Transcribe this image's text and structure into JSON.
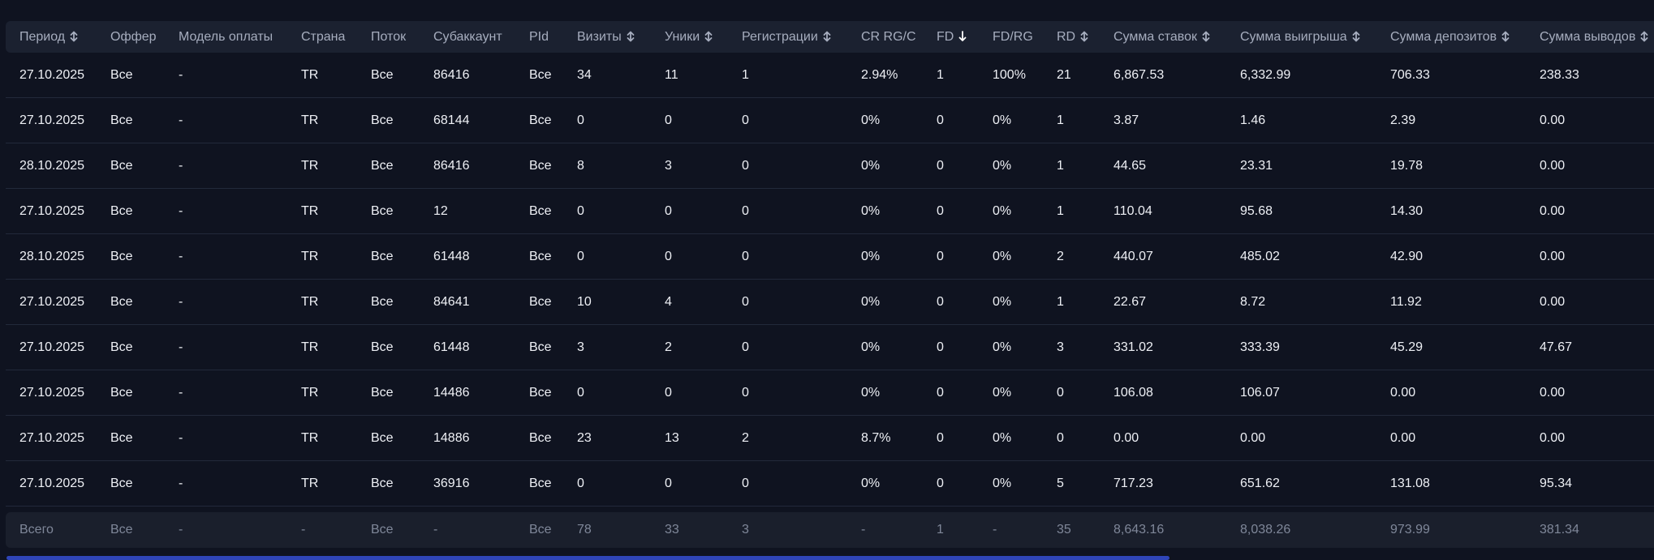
{
  "columns": [
    {
      "label": "Период",
      "sort": "both"
    },
    {
      "label": "Оффер",
      "sort": "none"
    },
    {
      "label": "Модель оплаты",
      "sort": "none"
    },
    {
      "label": "Страна",
      "sort": "none"
    },
    {
      "label": "Поток",
      "sort": "none"
    },
    {
      "label": "Субаккаунт",
      "sort": "none"
    },
    {
      "label": "PId",
      "sort": "none"
    },
    {
      "label": "Визиты",
      "sort": "both"
    },
    {
      "label": "Уники",
      "sort": "both"
    },
    {
      "label": "Регистрации",
      "sort": "both"
    },
    {
      "label": "CR RG/C",
      "sort": "none"
    },
    {
      "label": "FD",
      "sort": "down"
    },
    {
      "label": "FD/RG",
      "sort": "none"
    },
    {
      "label": "RD",
      "sort": "both"
    },
    {
      "label": "Сумма ставок",
      "sort": "both"
    },
    {
      "label": "Сумма выигрыша",
      "sort": "both"
    },
    {
      "label": "Сумма депозитов",
      "sort": "both"
    },
    {
      "label": "Сумма выводов",
      "sort": "both"
    }
  ],
  "rows": [
    [
      "27.10.2025",
      "Все",
      "-",
      "TR",
      "Все",
      "86416",
      "Все",
      "34",
      "11",
      "1",
      "2.94%",
      "1",
      "100%",
      "21",
      "6,867.53",
      "6,332.99",
      "706.33",
      "238.33"
    ],
    [
      "27.10.2025",
      "Все",
      "-",
      "TR",
      "Все",
      "68144",
      "Все",
      "0",
      "0",
      "0",
      "0%",
      "0",
      "0%",
      "1",
      "3.87",
      "1.46",
      "2.39",
      "0.00"
    ],
    [
      "28.10.2025",
      "Все",
      "-",
      "TR",
      "Все",
      "86416",
      "Все",
      "8",
      "3",
      "0",
      "0%",
      "0",
      "0%",
      "1",
      "44.65",
      "23.31",
      "19.78",
      "0.00"
    ],
    [
      "27.10.2025",
      "Все",
      "-",
      "TR",
      "Все",
      "12",
      "Все",
      "0",
      "0",
      "0",
      "0%",
      "0",
      "0%",
      "1",
      "110.04",
      "95.68",
      "14.30",
      "0.00"
    ],
    [
      "28.10.2025",
      "Все",
      "-",
      "TR",
      "Все",
      "61448",
      "Все",
      "0",
      "0",
      "0",
      "0%",
      "0",
      "0%",
      "2",
      "440.07",
      "485.02",
      "42.90",
      "0.00"
    ],
    [
      "27.10.2025",
      "Все",
      "-",
      "TR",
      "Все",
      "84641",
      "Все",
      "10",
      "4",
      "0",
      "0%",
      "0",
      "0%",
      "1",
      "22.67",
      "8.72",
      "11.92",
      "0.00"
    ],
    [
      "27.10.2025",
      "Все",
      "-",
      "TR",
      "Все",
      "61448",
      "Все",
      "3",
      "2",
      "0",
      "0%",
      "0",
      "0%",
      "3",
      "331.02",
      "333.39",
      "45.29",
      "47.67"
    ],
    [
      "27.10.2025",
      "Все",
      "-",
      "TR",
      "Все",
      "14486",
      "Все",
      "0",
      "0",
      "0",
      "0%",
      "0",
      "0%",
      "0",
      "106.08",
      "106.07",
      "0.00",
      "0.00"
    ],
    [
      "27.10.2025",
      "Все",
      "-",
      "TR",
      "Все",
      "14886",
      "Все",
      "23",
      "13",
      "2",
      "8.7%",
      "0",
      "0%",
      "0",
      "0.00",
      "0.00",
      "0.00",
      "0.00"
    ],
    [
      "27.10.2025",
      "Все",
      "-",
      "TR",
      "Все",
      "36916",
      "Все",
      "0",
      "0",
      "0",
      "0%",
      "0",
      "0%",
      "5",
      "717.23",
      "651.62",
      "131.08",
      "95.34"
    ]
  ],
  "total": [
    "Всего",
    "Все",
    "-",
    "-",
    "Все",
    "-",
    "Все",
    "78",
    "33",
    "3",
    "-",
    "1",
    "-",
    "35",
    "8,643.16",
    "8,038.26",
    "973.99",
    "381.34"
  ],
  "colors": {
    "bg": "#0f1320",
    "header_bg": "#1b2130",
    "accent_scroll": "#2f45b8"
  }
}
